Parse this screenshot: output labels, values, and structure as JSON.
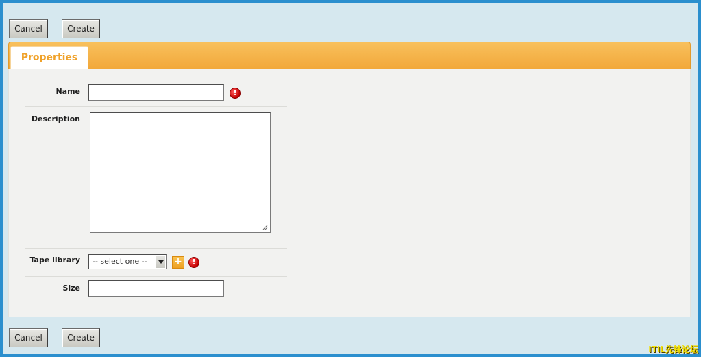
{
  "toolbar": {
    "cancel_label": "Cancel",
    "create_label": "Create"
  },
  "tabs": [
    {
      "label": "Properties"
    }
  ],
  "form": {
    "name": {
      "label": "Name",
      "value": ""
    },
    "description": {
      "label": "Description",
      "value": ""
    },
    "tape_library": {
      "label": "Tape library",
      "selected": "-- select one --",
      "add_symbol": "+"
    },
    "size": {
      "label": "Size",
      "value": ""
    }
  },
  "icons": {
    "required": "required-exclamation-icon",
    "required_glyph": "!",
    "add": "add-plus-icon",
    "dropdown": "chevron-down-icon"
  },
  "colors": {
    "frame_border": "#2b8fce",
    "background": "#d6e8ef",
    "tab_bar": "#f2a83a",
    "tab_text": "#f0a22a",
    "required": "#c40000"
  },
  "watermark": "ITIL先锋论坛"
}
